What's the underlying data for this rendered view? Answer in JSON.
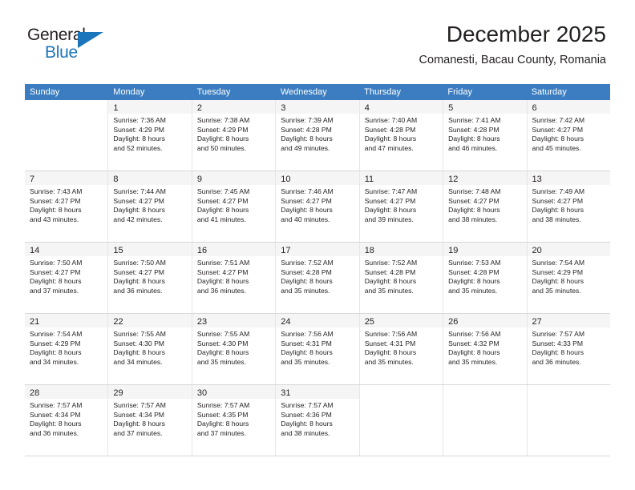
{
  "brand": {
    "name_top": "General",
    "name_bottom": "Blue",
    "accent_color": "#1b75bb"
  },
  "header": {
    "title": "December 2025",
    "subtitle": "Comanesti, Bacau County, Romania"
  },
  "calendar": {
    "header_bg": "#3b7dc0",
    "weekdays": [
      "Sunday",
      "Monday",
      "Tuesday",
      "Wednesday",
      "Thursday",
      "Friday",
      "Saturday"
    ],
    "weeks": [
      [
        {
          "day": "",
          "sunrise": "",
          "sunset": "",
          "daylight_line1": "",
          "daylight_line2": ""
        },
        {
          "day": "1",
          "sunrise": "Sunrise: 7:36 AM",
          "sunset": "Sunset: 4:29 PM",
          "daylight_line1": "Daylight: 8 hours",
          "daylight_line2": "and 52 minutes."
        },
        {
          "day": "2",
          "sunrise": "Sunrise: 7:38 AM",
          "sunset": "Sunset: 4:29 PM",
          "daylight_line1": "Daylight: 8 hours",
          "daylight_line2": "and 50 minutes."
        },
        {
          "day": "3",
          "sunrise": "Sunrise: 7:39 AM",
          "sunset": "Sunset: 4:28 PM",
          "daylight_line1": "Daylight: 8 hours",
          "daylight_line2": "and 49 minutes."
        },
        {
          "day": "4",
          "sunrise": "Sunrise: 7:40 AM",
          "sunset": "Sunset: 4:28 PM",
          "daylight_line1": "Daylight: 8 hours",
          "daylight_line2": "and 47 minutes."
        },
        {
          "day": "5",
          "sunrise": "Sunrise: 7:41 AM",
          "sunset": "Sunset: 4:28 PM",
          "daylight_line1": "Daylight: 8 hours",
          "daylight_line2": "and 46 minutes."
        },
        {
          "day": "6",
          "sunrise": "Sunrise: 7:42 AM",
          "sunset": "Sunset: 4:27 PM",
          "daylight_line1": "Daylight: 8 hours",
          "daylight_line2": "and 45 minutes."
        }
      ],
      [
        {
          "day": "7",
          "sunrise": "Sunrise: 7:43 AM",
          "sunset": "Sunset: 4:27 PM",
          "daylight_line1": "Daylight: 8 hours",
          "daylight_line2": "and 43 minutes."
        },
        {
          "day": "8",
          "sunrise": "Sunrise: 7:44 AM",
          "sunset": "Sunset: 4:27 PM",
          "daylight_line1": "Daylight: 8 hours",
          "daylight_line2": "and 42 minutes."
        },
        {
          "day": "9",
          "sunrise": "Sunrise: 7:45 AM",
          "sunset": "Sunset: 4:27 PM",
          "daylight_line1": "Daylight: 8 hours",
          "daylight_line2": "and 41 minutes."
        },
        {
          "day": "10",
          "sunrise": "Sunrise: 7:46 AM",
          "sunset": "Sunset: 4:27 PM",
          "daylight_line1": "Daylight: 8 hours",
          "daylight_line2": "and 40 minutes."
        },
        {
          "day": "11",
          "sunrise": "Sunrise: 7:47 AM",
          "sunset": "Sunset: 4:27 PM",
          "daylight_line1": "Daylight: 8 hours",
          "daylight_line2": "and 39 minutes."
        },
        {
          "day": "12",
          "sunrise": "Sunrise: 7:48 AM",
          "sunset": "Sunset: 4:27 PM",
          "daylight_line1": "Daylight: 8 hours",
          "daylight_line2": "and 38 minutes."
        },
        {
          "day": "13",
          "sunrise": "Sunrise: 7:49 AM",
          "sunset": "Sunset: 4:27 PM",
          "daylight_line1": "Daylight: 8 hours",
          "daylight_line2": "and 38 minutes."
        }
      ],
      [
        {
          "day": "14",
          "sunrise": "Sunrise: 7:50 AM",
          "sunset": "Sunset: 4:27 PM",
          "daylight_line1": "Daylight: 8 hours",
          "daylight_line2": "and 37 minutes."
        },
        {
          "day": "15",
          "sunrise": "Sunrise: 7:50 AM",
          "sunset": "Sunset: 4:27 PM",
          "daylight_line1": "Daylight: 8 hours",
          "daylight_line2": "and 36 minutes."
        },
        {
          "day": "16",
          "sunrise": "Sunrise: 7:51 AM",
          "sunset": "Sunset: 4:27 PM",
          "daylight_line1": "Daylight: 8 hours",
          "daylight_line2": "and 36 minutes."
        },
        {
          "day": "17",
          "sunrise": "Sunrise: 7:52 AM",
          "sunset": "Sunset: 4:28 PM",
          "daylight_line1": "Daylight: 8 hours",
          "daylight_line2": "and 35 minutes."
        },
        {
          "day": "18",
          "sunrise": "Sunrise: 7:52 AM",
          "sunset": "Sunset: 4:28 PM",
          "daylight_line1": "Daylight: 8 hours",
          "daylight_line2": "and 35 minutes."
        },
        {
          "day": "19",
          "sunrise": "Sunrise: 7:53 AM",
          "sunset": "Sunset: 4:28 PM",
          "daylight_line1": "Daylight: 8 hours",
          "daylight_line2": "and 35 minutes."
        },
        {
          "day": "20",
          "sunrise": "Sunrise: 7:54 AM",
          "sunset": "Sunset: 4:29 PM",
          "daylight_line1": "Daylight: 8 hours",
          "daylight_line2": "and 35 minutes."
        }
      ],
      [
        {
          "day": "21",
          "sunrise": "Sunrise: 7:54 AM",
          "sunset": "Sunset: 4:29 PM",
          "daylight_line1": "Daylight: 8 hours",
          "daylight_line2": "and 34 minutes."
        },
        {
          "day": "22",
          "sunrise": "Sunrise: 7:55 AM",
          "sunset": "Sunset: 4:30 PM",
          "daylight_line1": "Daylight: 8 hours",
          "daylight_line2": "and 34 minutes."
        },
        {
          "day": "23",
          "sunrise": "Sunrise: 7:55 AM",
          "sunset": "Sunset: 4:30 PM",
          "daylight_line1": "Daylight: 8 hours",
          "daylight_line2": "and 35 minutes."
        },
        {
          "day": "24",
          "sunrise": "Sunrise: 7:56 AM",
          "sunset": "Sunset: 4:31 PM",
          "daylight_line1": "Daylight: 8 hours",
          "daylight_line2": "and 35 minutes."
        },
        {
          "day": "25",
          "sunrise": "Sunrise: 7:56 AM",
          "sunset": "Sunset: 4:31 PM",
          "daylight_line1": "Daylight: 8 hours",
          "daylight_line2": "and 35 minutes."
        },
        {
          "day": "26",
          "sunrise": "Sunrise: 7:56 AM",
          "sunset": "Sunset: 4:32 PM",
          "daylight_line1": "Daylight: 8 hours",
          "daylight_line2": "and 35 minutes."
        },
        {
          "day": "27",
          "sunrise": "Sunrise: 7:57 AM",
          "sunset": "Sunset: 4:33 PM",
          "daylight_line1": "Daylight: 8 hours",
          "daylight_line2": "and 36 minutes."
        }
      ],
      [
        {
          "day": "28",
          "sunrise": "Sunrise: 7:57 AM",
          "sunset": "Sunset: 4:34 PM",
          "daylight_line1": "Daylight: 8 hours",
          "daylight_line2": "and 36 minutes."
        },
        {
          "day": "29",
          "sunrise": "Sunrise: 7:57 AM",
          "sunset": "Sunset: 4:34 PM",
          "daylight_line1": "Daylight: 8 hours",
          "daylight_line2": "and 37 minutes."
        },
        {
          "day": "30",
          "sunrise": "Sunrise: 7:57 AM",
          "sunset": "Sunset: 4:35 PM",
          "daylight_line1": "Daylight: 8 hours",
          "daylight_line2": "and 37 minutes."
        },
        {
          "day": "31",
          "sunrise": "Sunrise: 7:57 AM",
          "sunset": "Sunset: 4:36 PM",
          "daylight_line1": "Daylight: 8 hours",
          "daylight_line2": "and 38 minutes."
        },
        {
          "day": "",
          "sunrise": "",
          "sunset": "",
          "daylight_line1": "",
          "daylight_line2": ""
        },
        {
          "day": "",
          "sunrise": "",
          "sunset": "",
          "daylight_line1": "",
          "daylight_line2": ""
        },
        {
          "day": "",
          "sunrise": "",
          "sunset": "",
          "daylight_line1": "",
          "daylight_line2": ""
        }
      ]
    ]
  }
}
